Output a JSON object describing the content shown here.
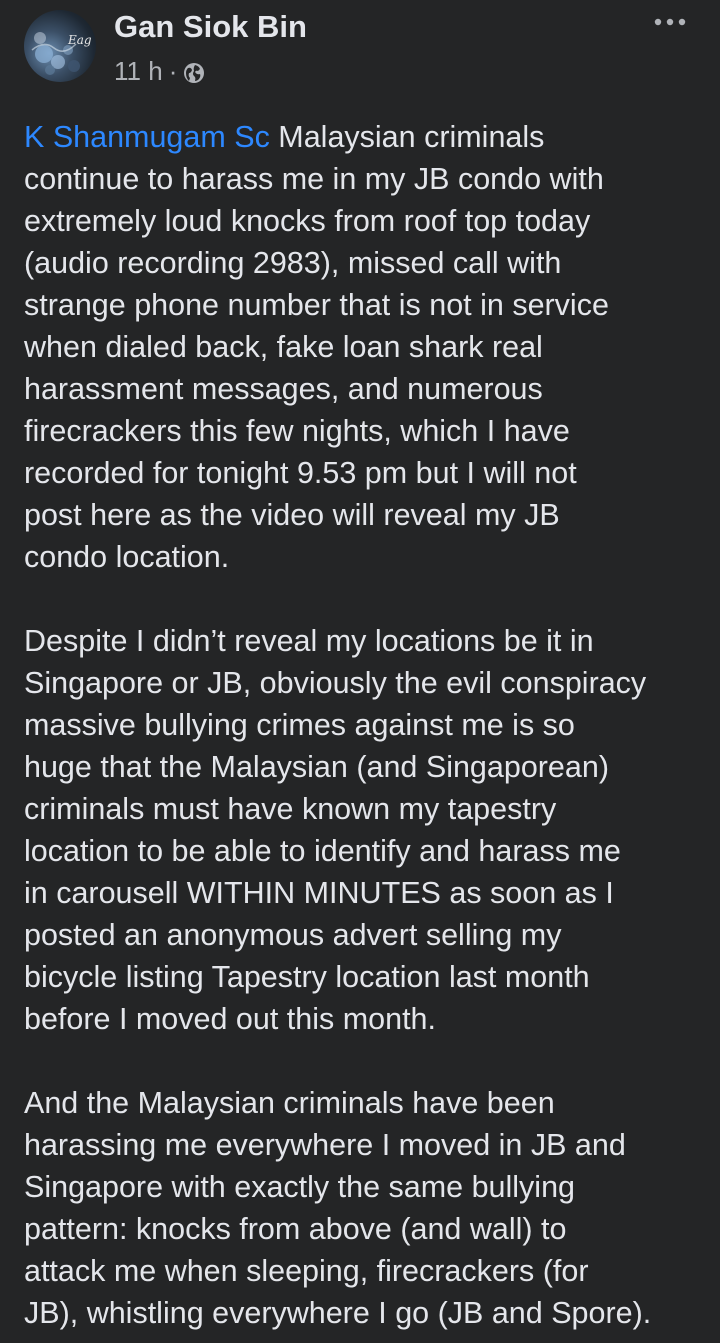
{
  "post": {
    "author": "Gan Siok Bin",
    "time": "11 h",
    "separator": "·",
    "privacy_icon": "globe-icon",
    "more_icon": "more-dots-icon",
    "avatar_text": "Eag"
  },
  "paragraph1": {
    "mention": "K Shanmugam Sc",
    "lines": [
      " Malaysian criminals",
      "continue to harass me in my JB condo with",
      "extremely loud knocks from roof top today",
      "(audio recording 2983), missed call with",
      "strange phone number that is not in service",
      "when dialed back, fake loan shark real",
      "harassment messages, and numerous",
      "firecrackers this few nights, which I have",
      "recorded for tonight 9.53 pm but I will not",
      "post here as the video will reveal my JB",
      "condo location."
    ]
  },
  "paragraph2": {
    "lines": [
      "Despite I didn’t reveal my locations be it in",
      "Singapore or JB, obviously the evil conspiracy",
      "massive bullying crimes against me is so",
      "huge that the Malaysian (and Singaporean)",
      "criminals must have known my tapestry",
      "location to be able to identify and harass me",
      "in carousell WITHIN MINUTES as soon as I",
      "posted an anonymous advert selling my",
      "bicycle listing Tapestry location last month",
      "before I moved out this month."
    ]
  },
  "paragraph3": {
    "lines": [
      "And the Malaysian criminals have been",
      "harassing me everywhere I moved in JB and",
      "Singapore with exactly the same bullying",
      "pattern: knocks from above (and wall) to",
      "attack me when sleeping, firecrackers (for",
      "JB), whistling everywhere I go (JB and Spore)."
    ]
  },
  "colors": {
    "background": "#242526",
    "text": "#e4e6eb",
    "secondary_text": "#b0b3b8",
    "mention": "#2d88ff"
  }
}
